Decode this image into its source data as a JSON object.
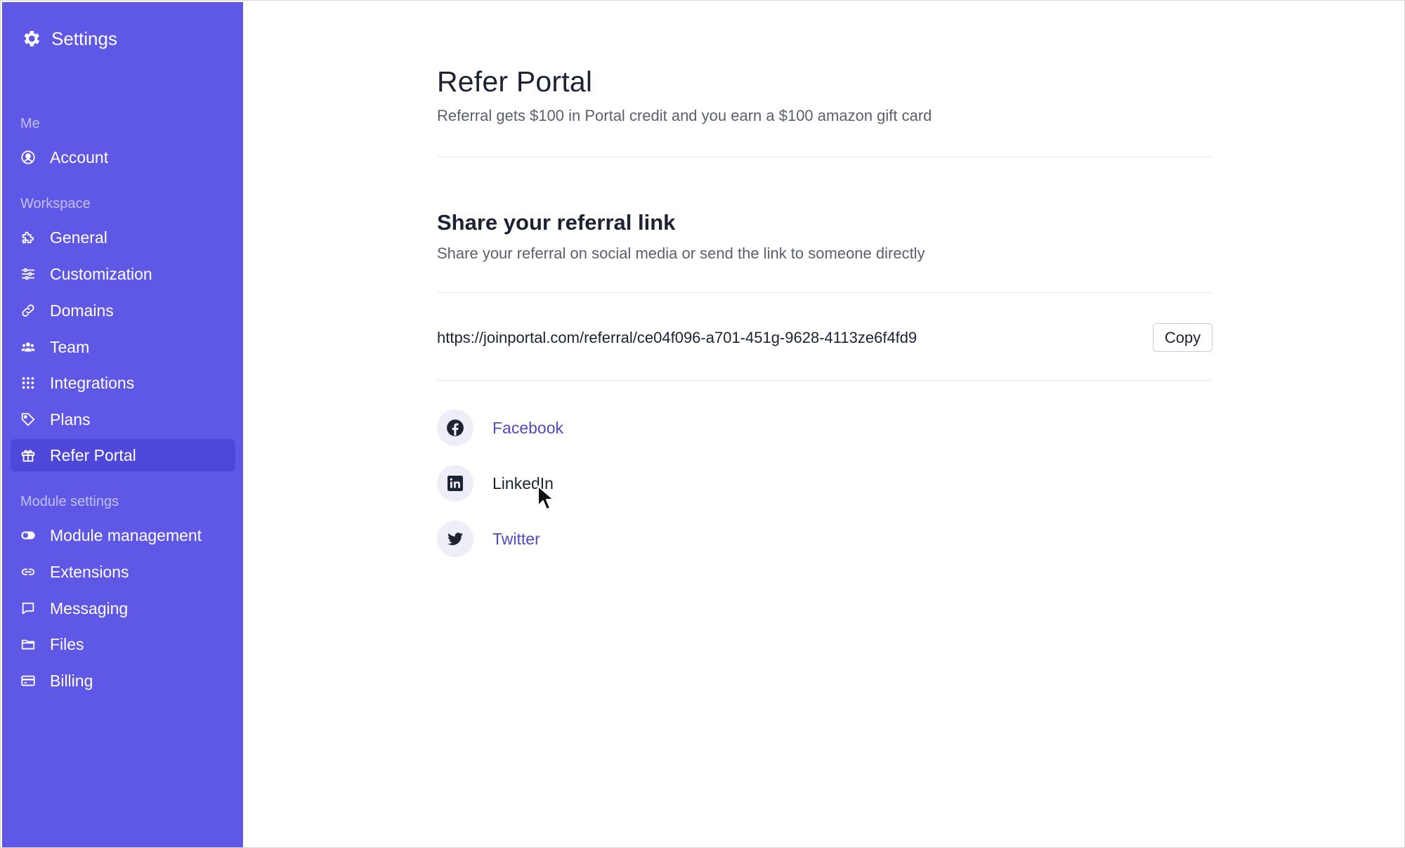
{
  "sidebar": {
    "title": "Settings",
    "title_icon": "gear-icon",
    "groups": [
      {
        "label": "Me",
        "items": [
          {
            "label": "Account",
            "icon": "user-circle-icon"
          }
        ]
      },
      {
        "label": "Workspace",
        "items": [
          {
            "label": "General",
            "icon": "puzzle-icon"
          },
          {
            "label": "Customization",
            "icon": "sliders-icon"
          },
          {
            "label": "Domains",
            "icon": "link-icon"
          },
          {
            "label": "Team",
            "icon": "users-icon"
          },
          {
            "label": "Integrations",
            "icon": "grid-dots-icon"
          },
          {
            "label": "Plans",
            "icon": "tag-icon"
          },
          {
            "label": "Refer Portal",
            "icon": "gift-icon",
            "active": true
          }
        ]
      },
      {
        "label": "Module settings",
        "items": [
          {
            "label": "Module management",
            "icon": "toggle-icon"
          },
          {
            "label": "Extensions",
            "icon": "chain-link-icon"
          },
          {
            "label": "Messaging",
            "icon": "chat-bubble-icon"
          },
          {
            "label": "Files",
            "icon": "folder-icon"
          },
          {
            "label": "Billing",
            "icon": "credit-card-icon"
          }
        ]
      }
    ]
  },
  "main": {
    "title": "Refer Portal",
    "subtitle": "Referral gets $100 in Portal credit and you earn a $100 amazon gift card",
    "share_section": {
      "title": "Share your referral link",
      "subtitle": "Share your referral on social media or send the link to someone directly",
      "referral_url": "https://joinportal.com/referral/ce04f096-a701-451g-9628-4113ze6f4fd9",
      "copy_label": "Copy"
    },
    "share_links": [
      {
        "label": "Facebook",
        "icon": "facebook-icon"
      },
      {
        "label": "LinkedIn",
        "icon": "linkedin-icon"
      },
      {
        "label": "Twitter",
        "icon": "twitter-icon"
      }
    ]
  },
  "colors": {
    "sidebar_bg": "#5f57e6",
    "sidebar_active_bg": "#4f47d9",
    "link": "#5149c9"
  }
}
